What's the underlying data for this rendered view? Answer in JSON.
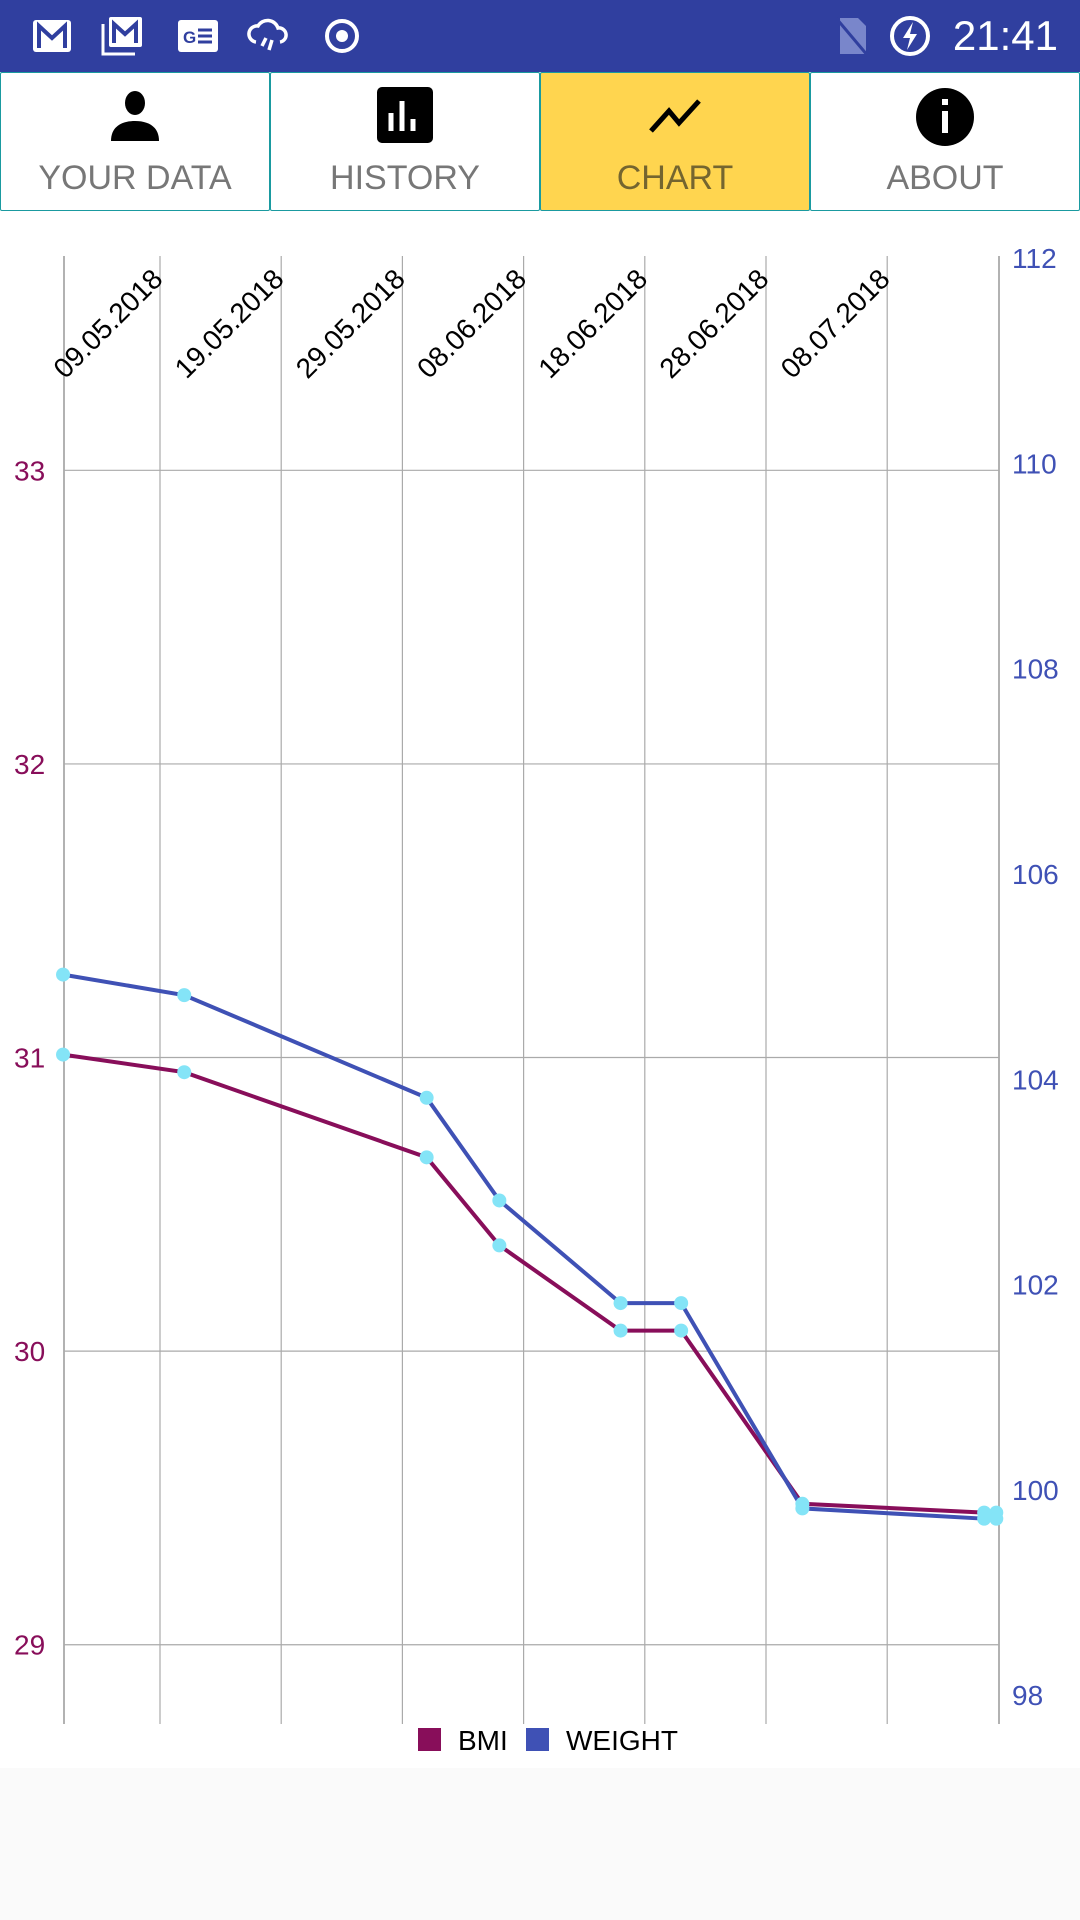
{
  "status_bar": {
    "time": "21:41",
    "icons": [
      "gmail-icon",
      "gmail-stack-icon",
      "news-icon",
      "cloud-rain-icon",
      "record-icon",
      "no-sim-icon",
      "battery-charging-icon"
    ]
  },
  "tabs": [
    {
      "label": "YOUR DATA",
      "icon": "person-icon",
      "active": false
    },
    {
      "label": "HISTORY",
      "icon": "bar-chart-icon",
      "active": false
    },
    {
      "label": "CHART",
      "icon": "line-chart-icon",
      "active": true
    },
    {
      "label": "ABOUT",
      "icon": "info-icon",
      "active": false
    }
  ],
  "colors": {
    "status_bar": "#303f9f",
    "active_tab": "#ffd54f",
    "bmi": "#880e5a",
    "weight": "#3f51b5",
    "points": "#84e4f7"
  },
  "chart_data": {
    "type": "line",
    "x_tick_labels": [
      "09.05.2018",
      "19.05.2018",
      "29.05.2018",
      "08.06.2018",
      "18.06.2018",
      "28.06.2018",
      "08.07.2018"
    ],
    "x": [
      "01.05.2018",
      "11.05.2018",
      "31.05.2018",
      "06.06.2018",
      "16.06.2018",
      "21.06.2018",
      "01.07.2018",
      "16.07.2018",
      "17.07.2018"
    ],
    "series": [
      {
        "name": "BMI",
        "axis": "left",
        "values": [
          31.01,
          30.95,
          30.66,
          30.36,
          30.07,
          30.07,
          29.48,
          29.45,
          29.45
        ]
      },
      {
        "name": "WEIGHT",
        "axis": "right",
        "values": [
          105.0,
          104.8,
          103.8,
          102.8,
          101.8,
          101.8,
          99.8,
          99.7,
          99.7
        ]
      }
    ],
    "y_left": {
      "ticks": [
        "29",
        "30",
        "31",
        "32",
        "33"
      ],
      "range": [
        28.73,
        33.73
      ]
    },
    "y_right": {
      "ticks": [
        "98",
        "100",
        "102",
        "104",
        "106",
        "108",
        "110",
        "112"
      ],
      "range": [
        97.7,
        112
      ]
    },
    "grid": true,
    "legend": "bottom-center"
  }
}
